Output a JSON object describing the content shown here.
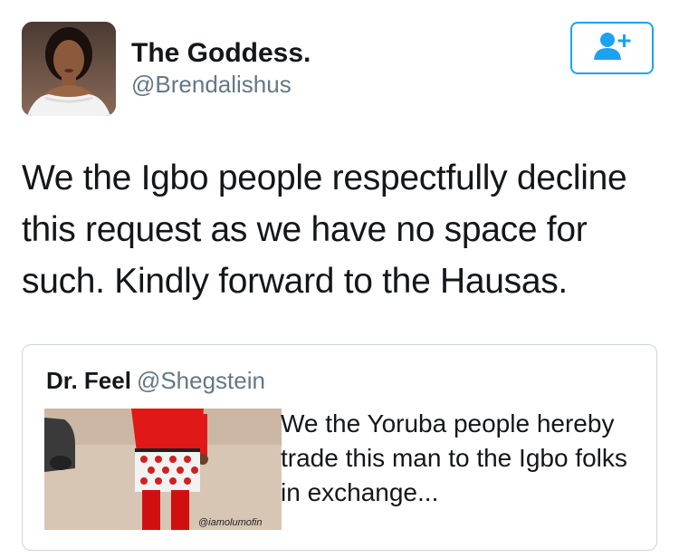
{
  "tweet": {
    "author": {
      "display_name": "The Goddess.",
      "handle": "@Brendalishus"
    },
    "follow_button": {
      "icon": "add-user-icon",
      "color": "#1da1f2"
    },
    "text": "We the Igbo people respectfully decline this request as we have no space for such. Kindly forward to the Hausas."
  },
  "quoted_tweet": {
    "author": {
      "display_name": "Dr. Feel",
      "handle": "@Shegstein"
    },
    "media": {
      "watermark": "@iamolumofin"
    },
    "text": "We the Yoruba people hereby trade this man to the Igbo folks in exchange..."
  },
  "colors": {
    "accent": "#1da1f2",
    "text": "#14171a",
    "secondary_text": "#657786",
    "border": "#ccd6dd"
  }
}
